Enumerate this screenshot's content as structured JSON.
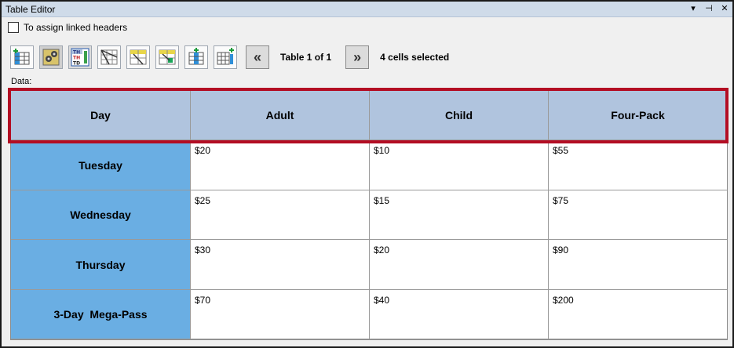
{
  "window": {
    "title": "Table Editor",
    "ctrl_dropdown": "▾",
    "ctrl_pin": "⊣",
    "ctrl_close": "✕"
  },
  "options": {
    "linked_headers_label": "To assign linked headers",
    "linked_headers_checked": false
  },
  "toolbar": {
    "tools": [
      {
        "name": "insert-table-icon"
      },
      {
        "name": "table-settings-icon"
      },
      {
        "name": "th-td-icon",
        "texts": [
          "TH",
          "TH",
          "TD"
        ]
      },
      {
        "name": "diagonal-header-icon"
      },
      {
        "name": "header-scope-icon"
      },
      {
        "name": "linked-header-icon"
      },
      {
        "name": "add-column-icon"
      },
      {
        "name": "add-row-icon"
      }
    ],
    "prev_label": "«",
    "next_label": "»",
    "table_count": "Table 1 of 1",
    "selection_status": "4 cells selected"
  },
  "data_label": "Data:",
  "table": {
    "headers": [
      "Day",
      "Adult",
      "Child",
      "Four-Pack"
    ],
    "rows": [
      {
        "label": "Tuesday",
        "cells": [
          "$20",
          "$10",
          "$55"
        ]
      },
      {
        "label": "Wednesday",
        "cells": [
          "$25",
          "$15",
          "$75"
        ]
      },
      {
        "label": "Thursday",
        "cells": [
          "$30",
          "$20",
          "$90"
        ]
      },
      {
        "label": "3-Day  Mega-Pass",
        "cells": [
          "$70",
          "$40",
          "$200"
        ]
      }
    ]
  },
  "colors": {
    "header_bg": "#b0c4de",
    "row_header_bg": "#6aaee3",
    "selection_outline": "#b30d23"
  }
}
